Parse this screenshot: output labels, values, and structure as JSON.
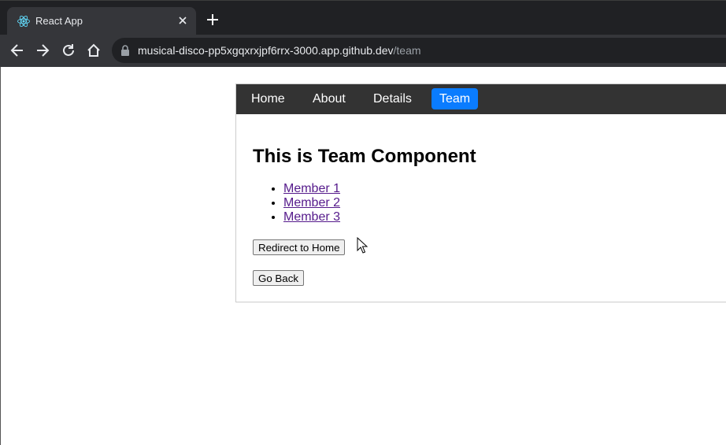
{
  "browser": {
    "tab_title": "React App",
    "url_host": "musical-disco-pp5xgqxrxjpf6rrx-3000.app.github.dev",
    "url_path": "/team"
  },
  "app": {
    "nav": [
      {
        "label": "Home",
        "active": false
      },
      {
        "label": "About",
        "active": false
      },
      {
        "label": "Details",
        "active": false
      },
      {
        "label": "Team",
        "active": true
      }
    ],
    "heading": "This is Team Component",
    "members": [
      "Member 1",
      "Member 2",
      "Member 3"
    ],
    "redirect_button": "Redirect to Home",
    "back_button": "Go Back"
  },
  "colors": {
    "active_nav": "#0a7cff",
    "navbar_bg": "#333333",
    "link_visited": "#551a8b"
  }
}
